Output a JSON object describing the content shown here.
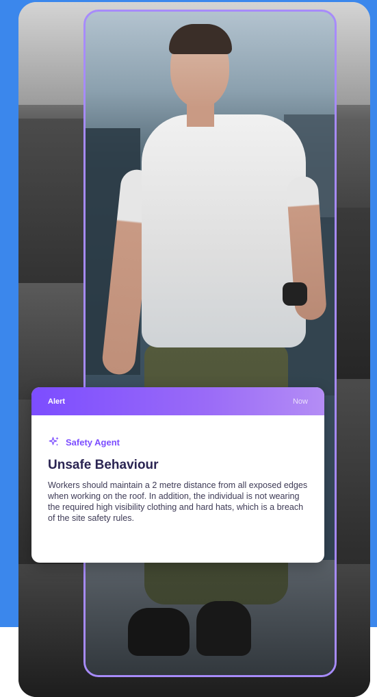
{
  "alert": {
    "label": "Alert",
    "time": "Now",
    "agent": {
      "name": "Safety Agent",
      "icon": "sparkle-icon"
    },
    "title": "Unsafe Behaviour",
    "description": "Workers should maintain a 2 metre distance from all exposed edges when working on the roof. In addition, the individual is not wearing the required high visibility clothing and hard hats, which is a breach of the site safety rules."
  },
  "colors": {
    "background_band": "#3b87ec",
    "accent": "#7c4dff",
    "detection_box": "#a78bfa",
    "title_text": "#2a2452"
  }
}
